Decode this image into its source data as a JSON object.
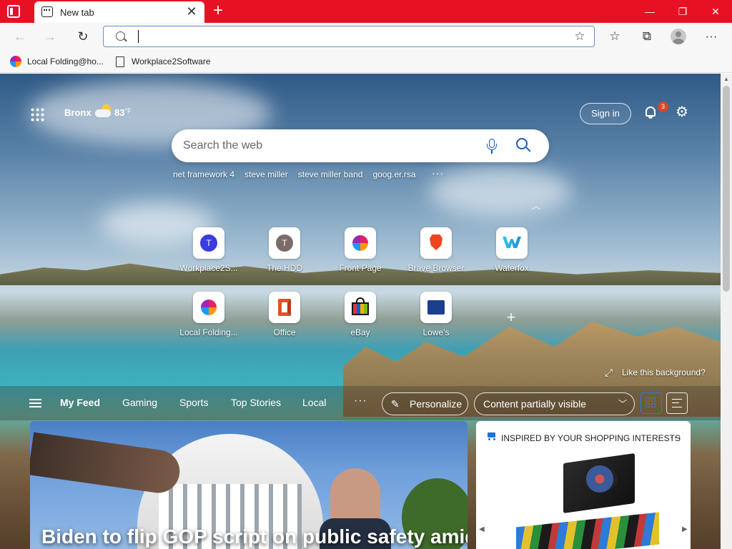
{
  "window": {
    "tab_title": "New tab",
    "new_tab_symbol": "+",
    "tab_close_symbol": "✕",
    "controls": {
      "minimize": "—",
      "restore": "❐",
      "close": "✕"
    },
    "accent_color": "#e81123"
  },
  "navbar": {
    "back_icon": "arrow-left-icon",
    "forward_icon": "arrow-right-icon",
    "refresh_icon": "refresh-icon",
    "address_value": "",
    "favorites_icon": "star-list-icon",
    "collections_icon": "collections-icon",
    "menu_icon": "more-horizontal-icon",
    "symbols": {
      "back": "←",
      "forward": "→",
      "refresh": "↻",
      "add_favorite": "☆",
      "favorites": "☆",
      "collections": "⧉",
      "more": "···"
    }
  },
  "favorites_bar": {
    "items": [
      {
        "label": "Local Folding@ho...",
        "icon": "multicolor-flower-icon"
      },
      {
        "label": "Workplace2Software",
        "icon": "page-icon"
      }
    ]
  },
  "header": {
    "location": "Bronx",
    "temperature": "83",
    "temperature_unit": "°F",
    "weather_icon": "partly-cloudy-icon",
    "sign_in_label": "Sign in",
    "notification_count": "3",
    "settings_symbol": "⚙"
  },
  "search": {
    "placeholder": "Search the web",
    "trending": [
      "net framework 4",
      "steve miller",
      "steve miller band",
      "goog.er.rsa"
    ],
    "trending_more": "···"
  },
  "quick_links": {
    "collapse_symbol": "︿",
    "add_symbol": "+",
    "row1": [
      {
        "label": "Workplace2S...",
        "icon": "letter-avatar-icon",
        "letter": "T",
        "color": "#3a3be0"
      },
      {
        "label": "The HDD",
        "icon": "letter-avatar-icon",
        "letter": "T",
        "color": "#7a6c68"
      },
      {
        "label": "Front Page",
        "icon": "multicolor-flower-icon"
      },
      {
        "label": "Brave Browser",
        "icon": "brave-lion-icon",
        "color": "#f0461f"
      },
      {
        "label": "Waterfox",
        "icon": "waterfox-icon",
        "color": "#2bb4e6"
      }
    ],
    "row2": [
      {
        "label": "Local Folding...",
        "icon": "multicolor-flower-icon"
      },
      {
        "label": "Office",
        "icon": "office-icon",
        "color": "#e2541f"
      },
      {
        "label": "eBay",
        "icon": "shopping-bag-icon"
      },
      {
        "label": "Lowe's",
        "icon": "lowes-logo-icon",
        "color": "#1c3e8f"
      }
    ]
  },
  "background": {
    "like_label": "Like this background?"
  },
  "feed": {
    "tabs": [
      "My Feed",
      "Gaming",
      "Sports",
      "Top Stories",
      "Local"
    ],
    "more": "···",
    "personalize_label": "Personalize",
    "visibility_label": "Content partially visible"
  },
  "cards": {
    "hero_headline": "Biden to flip GOP script on public safety amid",
    "shopping_title": "INSPIRED BY YOUR SHOPPING INTERESTS",
    "shopping_more": "···",
    "prev_symbol": "◀",
    "next_symbol": "▶"
  }
}
